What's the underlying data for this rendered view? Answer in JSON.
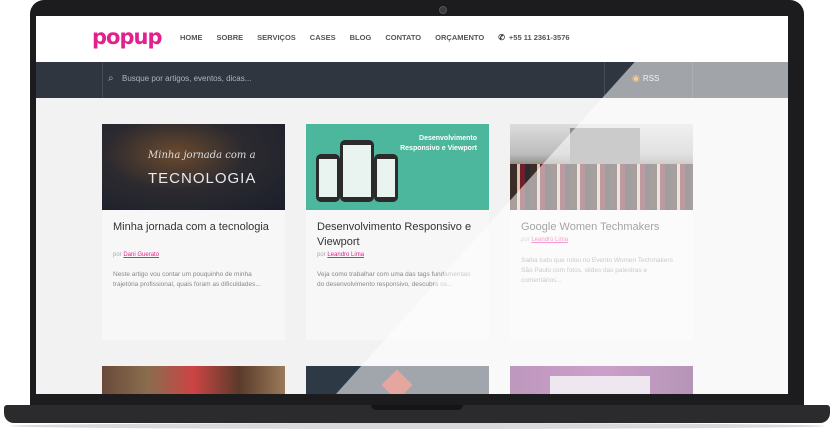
{
  "site": {
    "logo": "popup",
    "nav": [
      "HOME",
      "SOBRE",
      "SERVIÇOS",
      "CASES",
      "BLOG",
      "CONTATO",
      "ORÇAMENTO"
    ],
    "phone": "+55 11 2361-3576"
  },
  "search": {
    "placeholder": "Busque por artigos, eventos, dicas..."
  },
  "rss": {
    "label": "RSS"
  },
  "accent_color": "#e2218e",
  "posts": [
    {
      "thumb_script": "Minha jornada com a",
      "thumb_title": "TECNOLOGIA",
      "title": "Minha jornada com a tecnologia",
      "by": "por",
      "author": "Dani Guerato",
      "excerpt": "Neste artigo vou contar um pouquinho de minha trajetória profissional, quais foram as dificuldades..."
    },
    {
      "thumb_text": "Desenvolvimento Responsivo e Viewport",
      "title": "Desenvolvimento Responsivo e Viewport",
      "by": "por",
      "author": "Leandro Lima",
      "excerpt": "Veja como trabalhar com uma das tags fundamentais do desenvolvimento responsivo, descubra os..."
    },
    {
      "title": "Google Women Techmakers",
      "by": "por",
      "author": "Leandro Lima",
      "excerpt": "Saiba tudo que rolou no Evento Women Techmakers São Paulo com fotos, slides das palestras e comentários..."
    }
  ]
}
